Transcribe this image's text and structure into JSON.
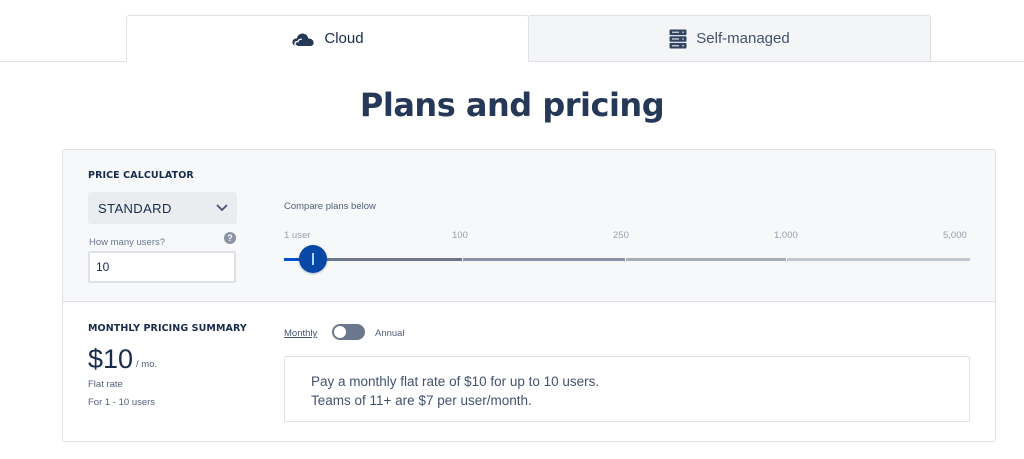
{
  "tabs": [
    {
      "label": "Cloud",
      "icon": "cloud-icon",
      "active": true
    },
    {
      "label": "Self-managed",
      "icon": "server-icon",
      "active": false
    }
  ],
  "page_title": "Plans and pricing",
  "calculator": {
    "heading": "PRICE CALCULATOR",
    "plan": "STANDARD",
    "users_label": "How many users?",
    "users_value": "10",
    "compare_label": "Compare plans below",
    "ticks": [
      "1 user",
      "100",
      "250",
      "1,000",
      "5,000"
    ],
    "slider_value": 10
  },
  "summary": {
    "heading": "MONTHLY PRICING SUMMARY",
    "price": "$10",
    "per": "/ mo.",
    "rate_type": "Flat rate",
    "range": "For 1 - 10 users",
    "billing_monthly": "Monthly",
    "billing_annual": "Annual",
    "billing_annual_selected": false,
    "description_line1": "Pay a monthly flat rate of $10 for up to 10 users.",
    "description_line2": "Teams of 11+ are $7 per user/month."
  },
  "colors": {
    "brand_blue": "#0052cc",
    "thumb": "#0747a6",
    "title": "#253858"
  }
}
